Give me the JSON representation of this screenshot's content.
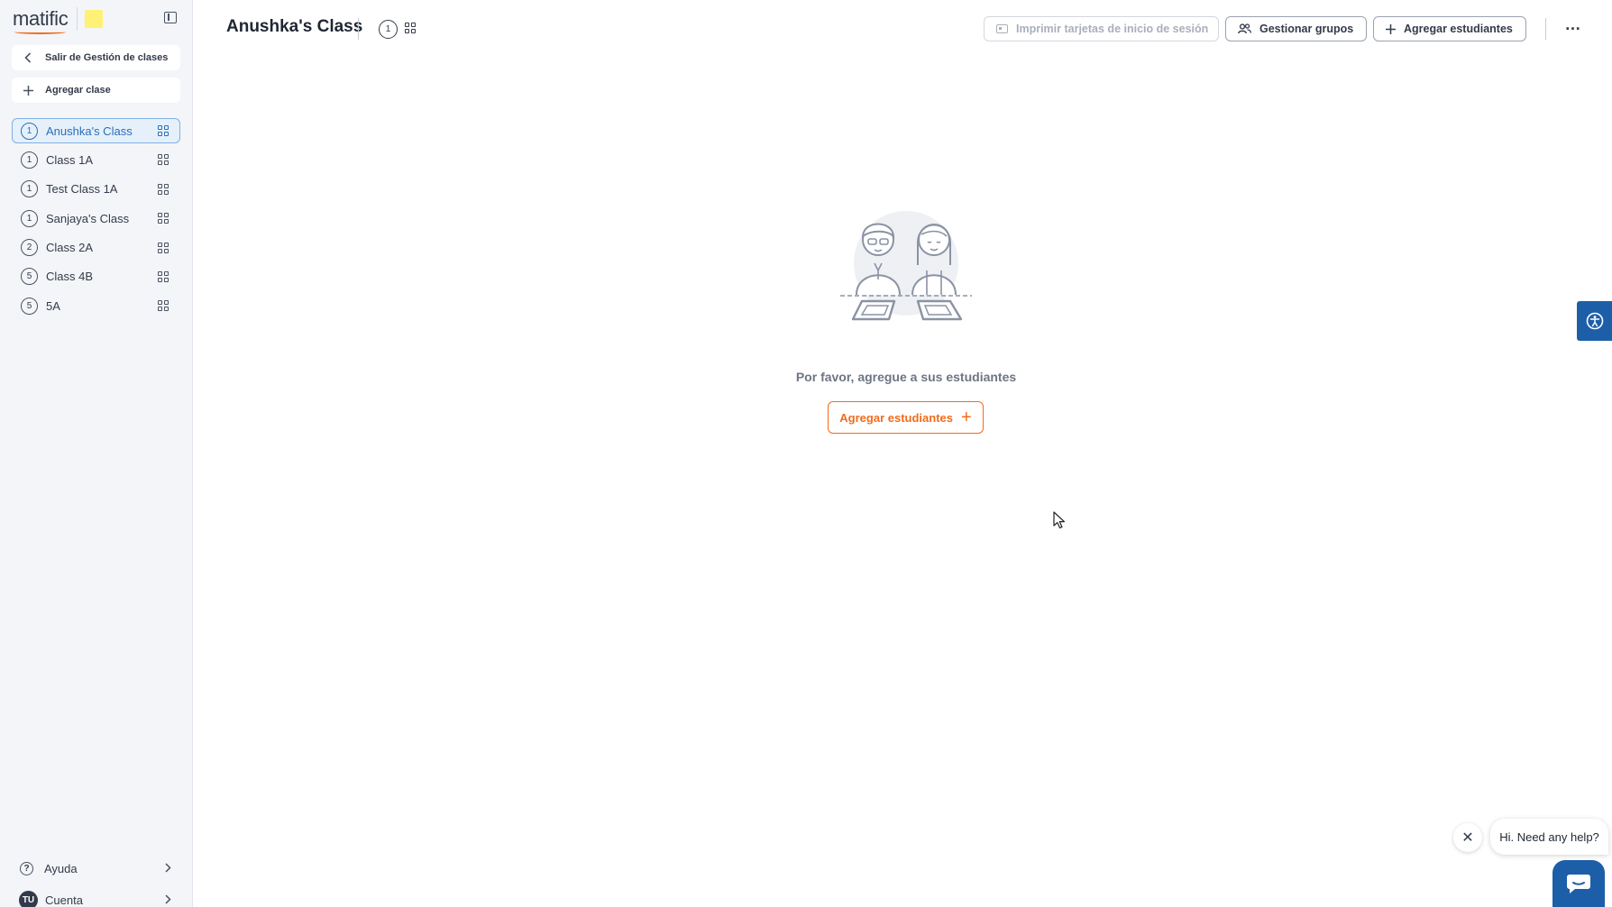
{
  "brand": {
    "logo_text": "matific",
    "badge_color": "#fff176"
  },
  "sidebar": {
    "exit_label": "Salir de Gestión de clases",
    "add_class_label": "Agregar clase",
    "classes": [
      {
        "grade": "1",
        "name": "Anushka's Class",
        "active": true
      },
      {
        "grade": "1",
        "name": "Class 1A"
      },
      {
        "grade": "1",
        "name": "Test Class 1A"
      },
      {
        "grade": "1",
        "name": "Sanjaya's Class"
      },
      {
        "grade": "2",
        "name": "Class 2A"
      },
      {
        "grade": "5",
        "name": "Class 4B"
      },
      {
        "grade": "5",
        "name": "5A"
      }
    ],
    "help_label": "Ayuda",
    "help_icon_text": "?",
    "account_label": "Cuenta",
    "account_initials": "TU"
  },
  "header": {
    "title": "Anushka's Class",
    "grade": "1",
    "print_cards_label": "Imprimir tarjetas de inicio de sesión",
    "manage_groups_label": "Gestionar grupos",
    "add_students_label": "Agregar estudiantes",
    "more_icon": "…"
  },
  "empty_state": {
    "message": "Por favor, agregue a sus estudiantes",
    "cta_label": "Agregar estudiantes",
    "cta_icon": "+"
  },
  "chat": {
    "greeting": "Hi. Need any help?",
    "close_icon": "✕"
  },
  "colors": {
    "accent_orange": "#f26b1d",
    "active_blue": "#2a6fb8",
    "widget_blue": "#1c5fa8",
    "sidebar_bg": "#f3f5f8"
  }
}
